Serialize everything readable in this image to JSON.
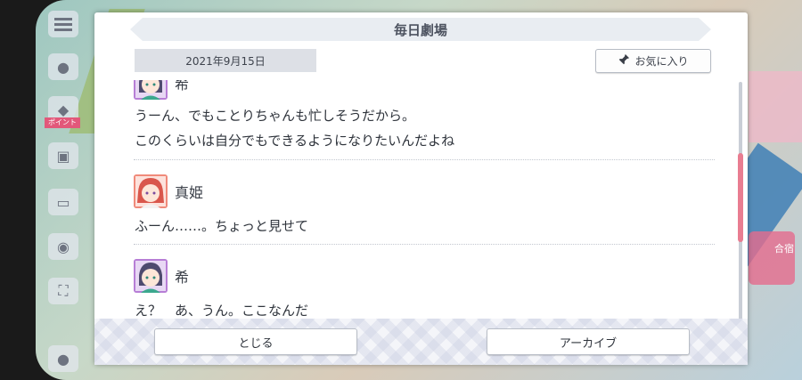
{
  "background": {
    "side_badge": "ポイント",
    "right_tag": "合宿"
  },
  "dialog": {
    "title": "毎日劇場",
    "date": "2021年9月15日",
    "favorite_label": "お気に入り",
    "entries": [
      {
        "speaker": "希",
        "lines": [
          "うーん、でもことりちゃんも忙しそうだから。",
          "このくらいは自分でもできるようになりたいんだよね"
        ]
      },
      {
        "speaker": "真姫",
        "lines": [
          "ふーん……。ちょっと見せて"
        ]
      },
      {
        "speaker": "希",
        "lines": [
          "え？　あ、うん。ここなんだ"
        ]
      }
    ],
    "close_label": "とじる",
    "archive_label": "アーカイブ"
  },
  "colors": {
    "scroll_thumb": "#e97d91",
    "nozomi_frame": "#b77ed6",
    "maki_frame": "#f08a7a"
  },
  "icons": {
    "favorite": "pushpin-icon",
    "menu": "hamburger-menu-icon"
  }
}
